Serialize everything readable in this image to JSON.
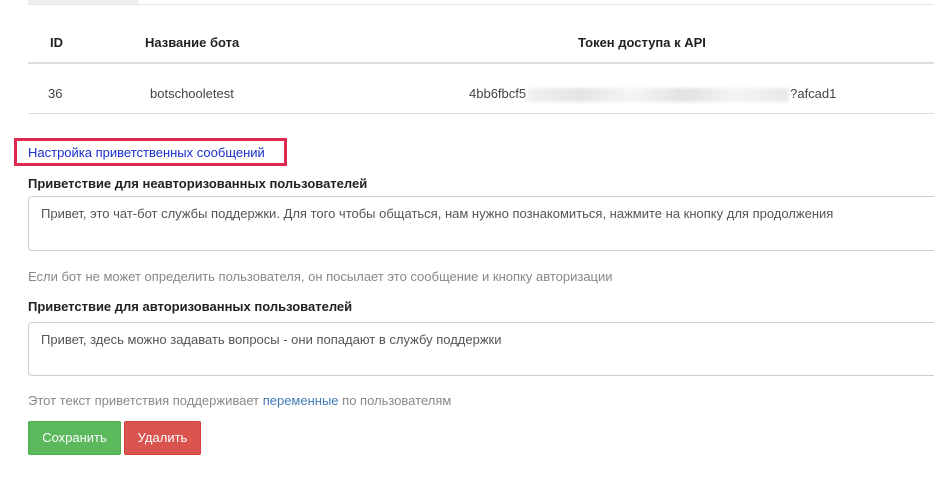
{
  "table": {
    "headers": {
      "id": "ID",
      "name": "Название бота",
      "token": "Токен доступа к API"
    },
    "row": {
      "id": "36",
      "name": "botschooletest",
      "token_start": "4bb6fbcf5",
      "token_end": "?afcad1"
    }
  },
  "settings_link": "Настройка приветственных сообщений",
  "unauth": {
    "label": "Приветствие для неавторизованных пользователей",
    "message": "Привет, это чат-бот службы поддержки. Для того чтобы общаться, нам нужно познакомиться, нажмите на кнопку для продолжения",
    "help": "Если бот не может определить пользователя, он посылает это сообщение и кнопку авторизации"
  },
  "auth": {
    "label": "Приветствие для авторизованных пользователей",
    "message": "Привет, здесь можно задавать вопросы - они попадают в службу поддержки"
  },
  "vars_help": {
    "before": "Этот текст приветствия поддерживает ",
    "link": "переменные",
    "after": " по пользователям"
  },
  "buttons": {
    "save": "Сохранить",
    "delete": "Удалить"
  },
  "colors": {
    "save": "#5cb85c",
    "delete": "#d9534f",
    "highlight_border": "#e0294f",
    "link": "#1a2fd0"
  }
}
